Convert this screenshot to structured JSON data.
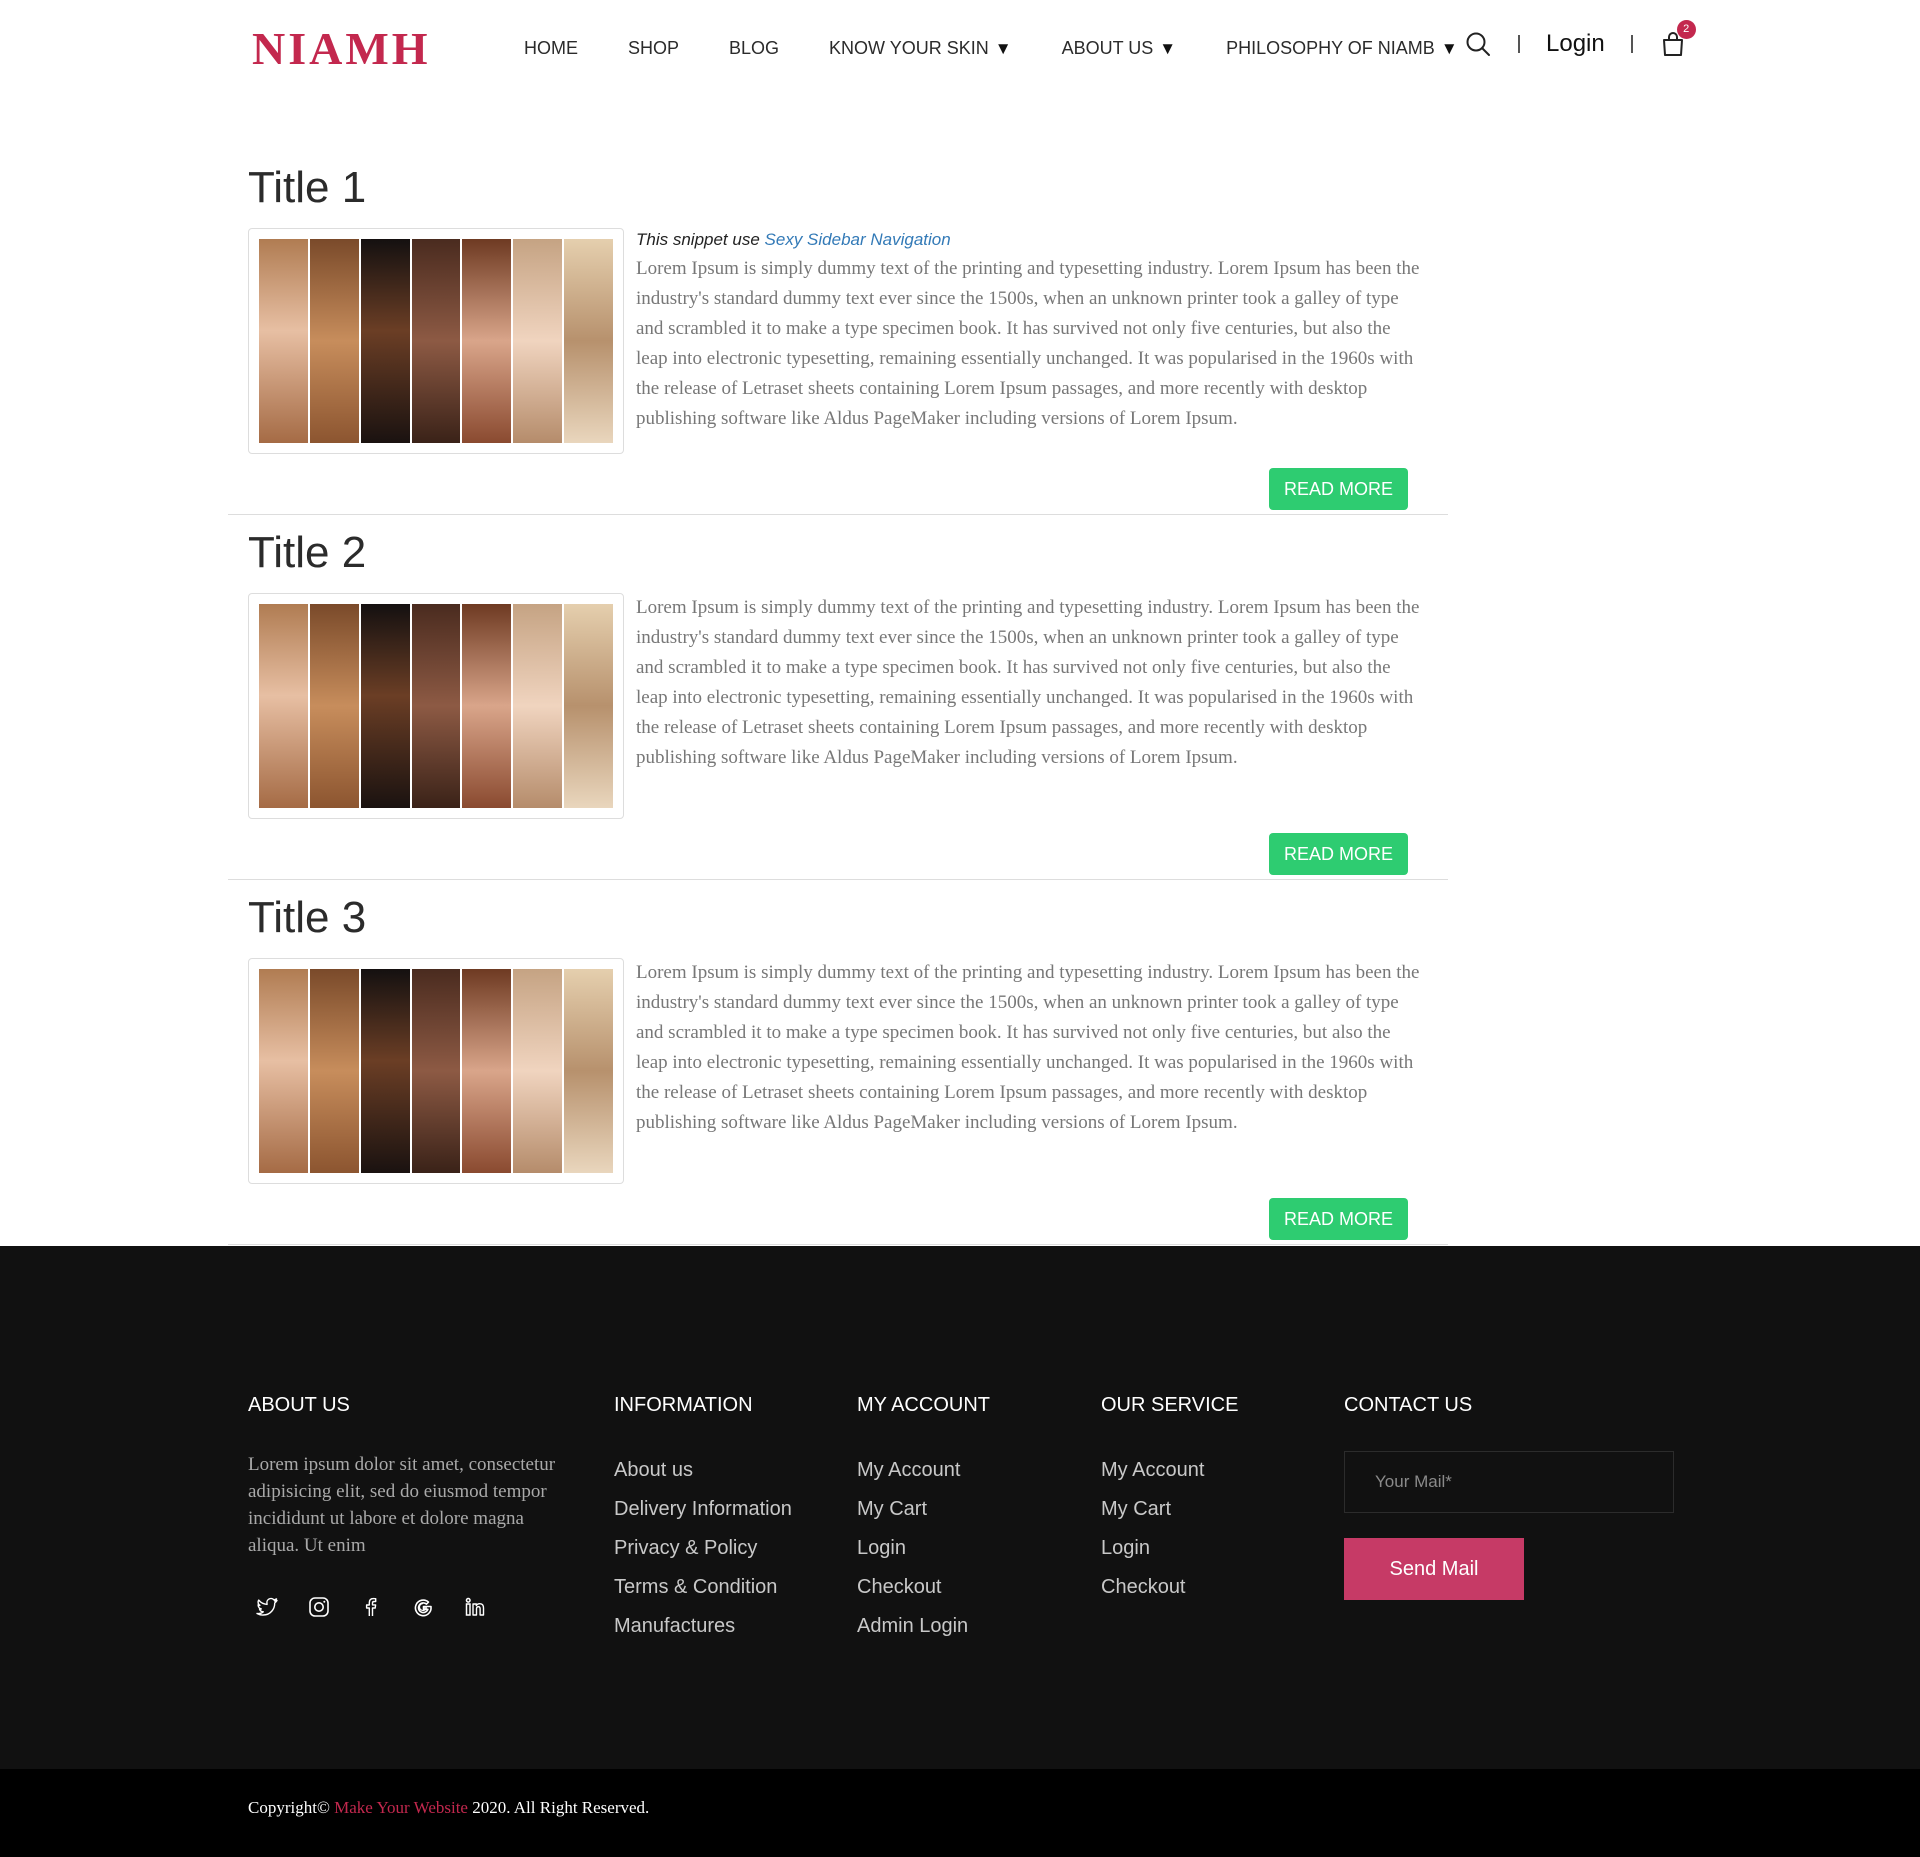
{
  "header": {
    "logo_text": "NIAMH",
    "nav": [
      {
        "label": "HOME",
        "dropdown": false
      },
      {
        "label": "SHOP",
        "dropdown": false
      },
      {
        "label": "BLOG",
        "dropdown": false
      },
      {
        "label": "KNOW YOUR SKIN",
        "dropdown": true
      },
      {
        "label": "ABOUT US",
        "dropdown": true
      },
      {
        "label": "PHILOSOPHY OF NIAMB",
        "dropdown": true
      }
    ],
    "caret": "▼",
    "login": "Login",
    "cart_count": "2"
  },
  "snippet": {
    "prefix": "This snippet use",
    "link": "Sexy Sidebar Navigation"
  },
  "posts": [
    {
      "title": "Title 1",
      "body": "Lorem Ipsum is simply dummy text of the printing and typesetting industry. Lorem Ipsum has been the industry's standard dummy text ever since the 1500s, when an unknown printer took a galley of type and scrambled it to make a type specimen book. It has survived not only five centuries, but also the leap into electronic typesetting, remaining essentially unchanged. It was popularised in the 1960s with the release of Letraset sheets containing Lorem Ipsum passages, and more recently with desktop publishing software like Aldus PageMaker including versions of Lorem Ipsum.",
      "button": "READ MORE"
    },
    {
      "title": "Title 2",
      "body": "Lorem Ipsum is simply dummy text of the printing and typesetting industry. Lorem Ipsum has been the industry's standard dummy text ever since the 1500s, when an unknown printer took a galley of type and scrambled it to make a type specimen book. It has survived not only five centuries, but also the leap into electronic typesetting, remaining essentially unchanged. It was popularised in the 1960s with the release of Letraset sheets containing Lorem Ipsum passages, and more recently with desktop publishing software like Aldus PageMaker including versions of Lorem Ipsum.",
      "button": "READ MORE"
    },
    {
      "title": "Title 3",
      "body": "Lorem Ipsum is simply dummy text of the printing and typesetting industry. Lorem Ipsum has been the industry's standard dummy text ever since the 1500s, when an unknown printer took a galley of type and scrambled it to make a type specimen book. It has survived not only five centuries, but also the leap into electronic typesetting, remaining essentially unchanged. It was popularised in the 1960s with the release of Letraset sheets containing Lorem Ipsum passages, and more recently with desktop publishing software like Aldus PageMaker including versions of Lorem Ipsum.",
      "button": "READ MORE"
    }
  ],
  "footer": {
    "about": {
      "heading": "ABOUT US",
      "text": "Lorem ipsum dolor sit amet, consectetur adipisicing elit, sed do eiusmod tempor incididunt ut labore et dolore magna aliqua. Ut enim",
      "socials": [
        "twitter-icon",
        "instagram-icon",
        "facebook-icon",
        "google-icon",
        "linkedin-icon"
      ]
    },
    "information": {
      "heading": "INFORMATION",
      "links": [
        "About us",
        "Delivery Information",
        "Privacy & Policy",
        "Terms & Condition",
        "Manufactures"
      ]
    },
    "my_account": {
      "heading": "MY ACCOUNT",
      "links": [
        "My Account",
        "My Cart",
        "Login",
        "Checkout",
        "Admin Login"
      ]
    },
    "our_service": {
      "heading": "OUR SERVICE",
      "links": [
        "My Account",
        "My Cart",
        "Login",
        "Checkout"
      ]
    },
    "contact": {
      "heading": "CONTACT US",
      "placeholder": "Your Mail*",
      "button": "Send Mail"
    }
  },
  "copyright": {
    "prefix": "Copyright©",
    "brand": "Make Your Website",
    "suffix": "2020. All Right Reserved."
  },
  "colors": {
    "brand": "#c3284e",
    "read_more": "#2ecc71",
    "send_button": "#c63a66",
    "footer_bg": "#111111"
  }
}
